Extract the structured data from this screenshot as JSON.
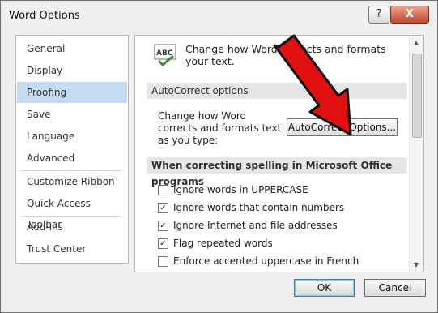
{
  "window": {
    "title": "Word Options",
    "help_glyph": "?",
    "close_glyph": "X"
  },
  "nav": {
    "items": [
      "General",
      "Display",
      "Proofing",
      "Save",
      "Language",
      "Advanced",
      "Customize Ribbon",
      "Quick Access Toolbar",
      "Add-Ins",
      "Trust Center"
    ],
    "selected": "Proofing"
  },
  "content": {
    "intro": "Change how Word corrects and formats your text.",
    "icon_letters": "ABC",
    "autocorrect_section": "AutoCorrect options",
    "autocorrect_desc": "Change how Word corrects and formats text as you type:",
    "autocorrect_button": "AutoCorrect Options...",
    "spelling_section": "When correcting spelling in Microsoft Office programs",
    "options": [
      {
        "label": "Ignore words in UPPERCASE",
        "checked": false
      },
      {
        "label": "Ignore words that contain numbers",
        "checked": true
      },
      {
        "label": "Ignore Internet and file addresses",
        "checked": true
      },
      {
        "label": "Flag repeated words",
        "checked": true
      },
      {
        "label": "Enforce accented uppercase in French",
        "checked": false
      }
    ]
  },
  "footer": {
    "ok": "OK",
    "cancel": "Cancel"
  },
  "colors": {
    "selected_nav": "#c5dbf4",
    "annotation_arrow": "#e01010"
  }
}
